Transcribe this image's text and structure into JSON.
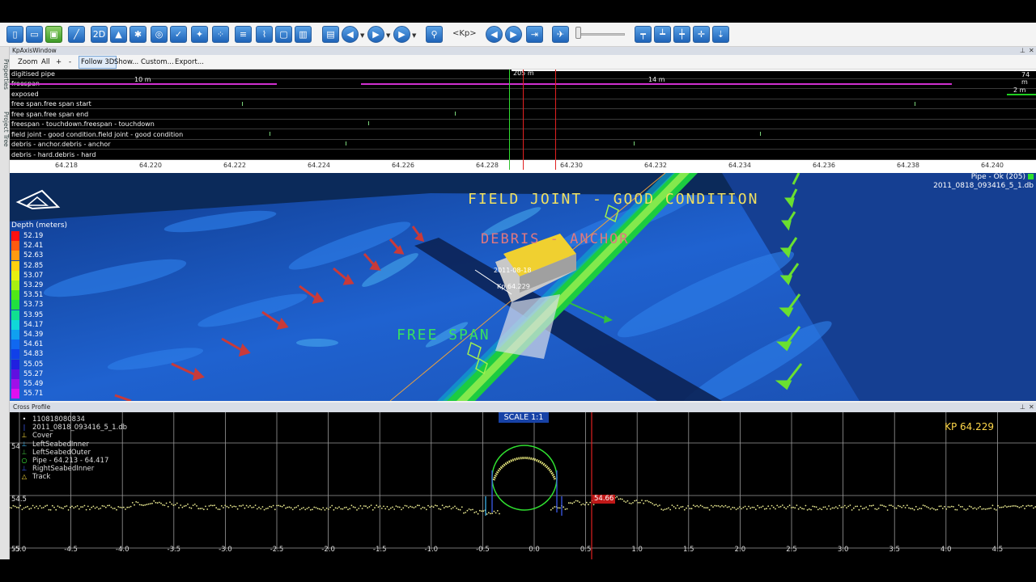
{
  "toolbar": {
    "kp_label": "<Kp>",
    "buttons_left": [
      "new-file",
      "open-folder",
      "save",
      "measure-tool",
      "2d-view",
      "navigate-arrow",
      "settings-gear",
      "pipe-tool",
      "check-tool",
      "network-tool",
      "ruler-tool",
      "route-tool",
      "frame-tool",
      "book-tool"
    ],
    "buttons_media": [
      "video-camera",
      "step-back",
      "play",
      "play-options"
    ],
    "buttons_right": [
      "key-tool",
      "nav-back",
      "nav-forward",
      "export-tool",
      "aircraft-view",
      "align-top",
      "align-bottom",
      "distribute",
      "fit-view",
      "pin-view"
    ]
  },
  "side_tabs": {
    "properties": "Properties",
    "project_tree": "Project Tree"
  },
  "kp_window": {
    "title": "KpAxisWindow",
    "menu": {
      "zoom": "Zoom",
      "all": "All",
      "plus": "+",
      "minus": "-",
      "follow3d": "Follow 3D",
      "show": "Show...",
      "custom": "Custom...",
      "export": "Export..."
    },
    "tracks": [
      "digitised pipe",
      "freespan",
      "exposed",
      "free span.free span start",
      "free span.free span end",
      "freespan - touchdown.freespan - touchdown",
      "field joint - good condition.field joint - good condition",
      "debris - anchor.debris - anchor",
      "debris - hard.debris - hard"
    ],
    "span_labels": {
      "span1": "10 m",
      "span2": "14 m",
      "span3": "2 m",
      "top_marker": "205 m",
      "top_right": "74 m"
    },
    "axis_ticks": [
      "64.218",
      "64.220",
      "64.222",
      "64.224",
      "64.226",
      "64.228",
      "64.230",
      "64.232",
      "64.234",
      "64.236",
      "64.238",
      "64.240"
    ]
  },
  "view3d": {
    "legend_title": "Depth (meters)",
    "legend": [
      {
        "v": "52.19",
        "c": "#ff1010"
      },
      {
        "v": "52.41",
        "c": "#ff5a10"
      },
      {
        "v": "52.63",
        "c": "#ff9a10"
      },
      {
        "v": "52.85",
        "c": "#ffd010"
      },
      {
        "v": "53.07",
        "c": "#e8f010"
      },
      {
        "v": "53.29",
        "c": "#a8f010"
      },
      {
        "v": "53.51",
        "c": "#50e818"
      },
      {
        "v": "53.73",
        "c": "#20e040"
      },
      {
        "v": "53.95",
        "c": "#10e090"
      },
      {
        "v": "54.17",
        "c": "#10d8d8"
      },
      {
        "v": "54.39",
        "c": "#10a0f0"
      },
      {
        "v": "54.61",
        "c": "#1068f0"
      },
      {
        "v": "54.83",
        "c": "#1040e8"
      },
      {
        "v": "55.05",
        "c": "#2020e0"
      },
      {
        "v": "55.27",
        "c": "#6010e0"
      },
      {
        "v": "55.49",
        "c": "#a010e8"
      },
      {
        "v": "55.71",
        "c": "#e010f0"
      }
    ],
    "labels": {
      "field_joint": "FIELD JOINT - GOOD CONDITION",
      "debris": "DEBRIS - ANCHOR",
      "free_span": "FREE SPAN",
      "rov_date": "2011-08-18",
      "rov_kp": "Kp 64.229"
    },
    "pipe_info": {
      "line1": "Pipe - Ok (205)",
      "line2": "2011_0818_093416_5_1.db"
    }
  },
  "cross_profile": {
    "title": "Cross Profile",
    "scale": "SCALE 1:1",
    "kp_readout": "KP 64.229",
    "depth_readout": "54.66",
    "legend": [
      {
        "sym": "•",
        "color": "#ffffff",
        "text": "110818080834"
      },
      {
        "sym": "|",
        "color": "#4060ff",
        "text": "2011_0818_093416_5_1.db"
      },
      {
        "sym": "⊥",
        "color": "#ffe040",
        "text": "Cover"
      },
      {
        "sym": "⊥",
        "color": "#40c0ff",
        "text": "LeftSeabedInner"
      },
      {
        "sym": "⊥",
        "color": "#40c040",
        "text": "LeftSeabedOuter"
      },
      {
        "sym": "○",
        "color": "#40ff40",
        "text": "Pipe - 64.213 - 64.417"
      },
      {
        "sym": "⊥",
        "color": "#4060ff",
        "text": "RightSeabedInner"
      },
      {
        "sym": "△",
        "color": "#ffe040",
        "text": "Track"
      }
    ],
    "y_labels": [
      "54",
      "54.5",
      "55"
    ],
    "x_labels": [
      "-5.0",
      "-4.5",
      "-4.0",
      "-3.5",
      "-3.0",
      "-2.5",
      "-2.0",
      "-1.5",
      "-1.0",
      "-0.5",
      "0.0",
      "0.5",
      "1.0",
      "1.5",
      "2.0",
      "2.5",
      "3.0",
      "3.5",
      "4.0",
      "4.5"
    ]
  }
}
